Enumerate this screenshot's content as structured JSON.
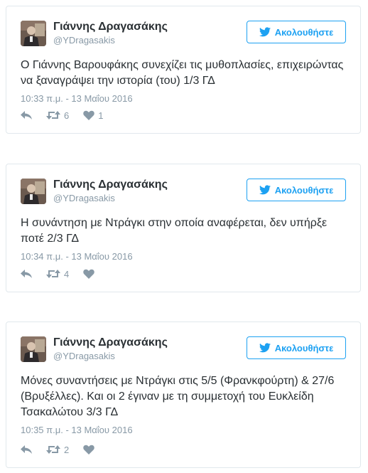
{
  "colors": {
    "accent": "#1da1f2",
    "text": "#292f33",
    "muted": "#8899a6",
    "border": "#e1e8ed"
  },
  "tweets": [
    {
      "author_name": "Γιάννης Δραγασάκης",
      "author_handle": "@YDragasakis",
      "follow_label": "Ακολουθήστε",
      "text": "Ο Γιάννης Βαρουφάκης συνεχίζει τις μυθοπλασίες, επιχειρώντας να ξαναγράψει την ιστορία (του) 1/3 ΓΔ",
      "timestamp": "10:33 π.μ. - 13 Μαΐου 2016",
      "retweets": "6",
      "likes": "1"
    },
    {
      "author_name": "Γιάννης Δραγασάκης",
      "author_handle": "@YDragasakis",
      "follow_label": "Ακολουθήστε",
      "text": "Η συνάντηση με Ντράγκι στην οποία αναφέρεται, δεν υπήρξε ποτέ 2/3 ΓΔ",
      "timestamp": "10:34 π.μ. - 13 Μαΐου 2016",
      "retweets": "4",
      "likes": ""
    },
    {
      "author_name": "Γιάννης Δραγασάκης",
      "author_handle": "@YDragasakis",
      "follow_label": "Ακολουθήστε",
      "text": "Μόνες συναντήσεις με Ντράγκι στις 5/5 (Φρανκφούρτη) & 27/6 (Βρυξέλλες). Και οι 2 έγιναν με τη συμμετοχή του Ευκλείδη Τσακαλώτου 3/3 ΓΔ",
      "timestamp": "10:35 π.μ. - 13 Μαΐου 2016",
      "retweets": "2",
      "likes": ""
    }
  ],
  "icons": {
    "reply": "reply-icon",
    "retweet": "retweet-icon",
    "like": "heart-icon",
    "bird": "twitter-bird-icon",
    "avatar": "avatar"
  }
}
